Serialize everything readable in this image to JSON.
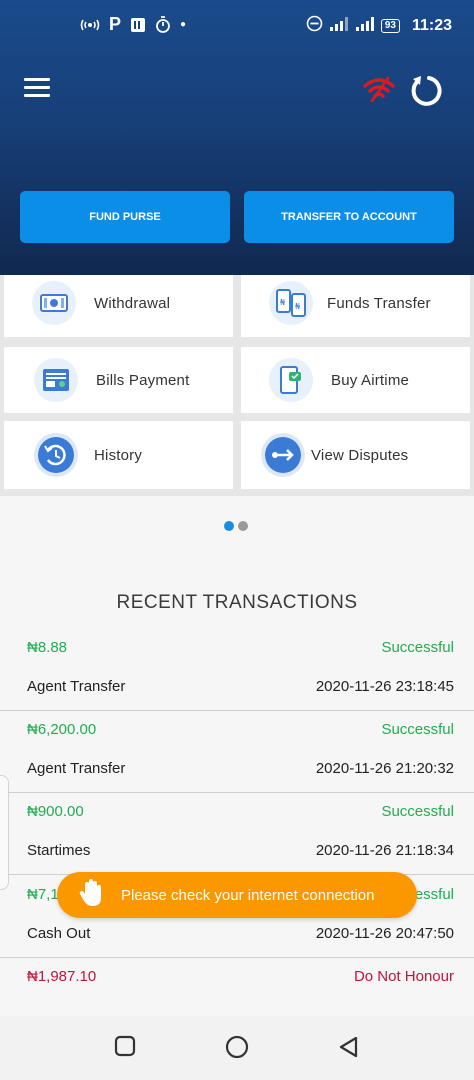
{
  "status_bar": {
    "time": "11:23",
    "battery": "93",
    "left_icons": [
      "nfc-icon",
      "parking-icon",
      "sim-card-icon",
      "stopwatch-icon",
      "dot-icon"
    ],
    "right_icons": [
      "do-not-disturb-icon",
      "signal-icon",
      "signal-icon",
      "battery-icon"
    ]
  },
  "header": {
    "menu_icon": "hamburger-icon",
    "network_icon": "wifi-offline-icon",
    "refresh_icon": "refresh-icon",
    "fund_purse": "FUND PURSE",
    "transfer_to_account": "TRANSFER TO ACCOUNT",
    "accent_color": "#0b8ee8"
  },
  "services": [
    {
      "label": "Withdrawal",
      "icon": "cash-icon"
    },
    {
      "label": "Funds Transfer",
      "icon": "phone-transfer-icon"
    },
    {
      "label": "Bills Payment",
      "icon": "bill-icon"
    },
    {
      "label": "Buy Airtime",
      "icon": "phone-airtime-icon"
    },
    {
      "label": "History",
      "icon": "history-icon"
    },
    {
      "label": "View Disputes",
      "icon": "dispute-arrow-icon"
    }
  ],
  "pager": {
    "active_dot_color": "#1a8de0",
    "inactive_dot_color": "#9a9a9a"
  },
  "recent": {
    "title": "RECENT TRANSACTIONS",
    "transactions": [
      {
        "amount": "₦8.88",
        "status": "Successful",
        "type": "Agent Transfer",
        "time": "2020-11-26 23:18:45"
      },
      {
        "amount": "₦6,200.00",
        "status": "Successful",
        "type": "Agent Transfer",
        "time": "2020-11-26 21:20:32"
      },
      {
        "amount": "₦900.00",
        "status": "Successful",
        "type": "Startimes",
        "time": "2020-11-26 21:18:34"
      },
      {
        "amount": "₦7,1",
        "status": "essful",
        "type": "Cash Out",
        "time": "2020-11-26 20:47:50"
      },
      {
        "amount": "₦1,987.10",
        "status": "Do Not Honour",
        "type": "",
        "time": ""
      }
    ]
  },
  "toast": {
    "message": "Please check your internet connection",
    "icon": "hand-icon",
    "color": "#fb9800"
  },
  "nav": {
    "recents": "square-icon",
    "home": "circle-icon",
    "back": "triangle-back-icon"
  },
  "colors": {
    "success": "#1fae4f",
    "failure": "#c0143c"
  }
}
